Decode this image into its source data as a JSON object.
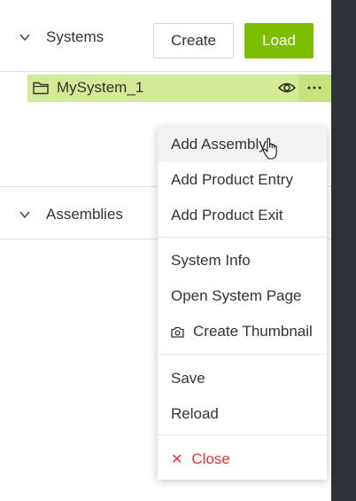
{
  "systems_section": {
    "title": "Systems",
    "create_label": "Create",
    "load_label": "Load",
    "items": [
      {
        "name": "MySystem_1",
        "selected": true
      }
    ]
  },
  "assemblies_section": {
    "title": "Assemblies"
  },
  "context_menu": {
    "hovered_item": "Add Assembly",
    "groups": [
      [
        {
          "label": "Add Assembly"
        },
        {
          "label": "Add Product Entry"
        },
        {
          "label": "Add Product Exit"
        }
      ],
      [
        {
          "label": "System Info"
        },
        {
          "label": "Open System Page"
        },
        {
          "label": "Create Thumbnail",
          "icon": "camera-icon"
        }
      ],
      [
        {
          "label": "Save"
        },
        {
          "label": "Reload"
        }
      ],
      [
        {
          "label": "Close",
          "icon": "close-icon",
          "danger": true
        }
      ]
    ]
  },
  "colors": {
    "accent": "#7cbf00",
    "selected_row": "#d4ea96",
    "danger": "#e0353b",
    "backdrop": "#2f3138"
  }
}
